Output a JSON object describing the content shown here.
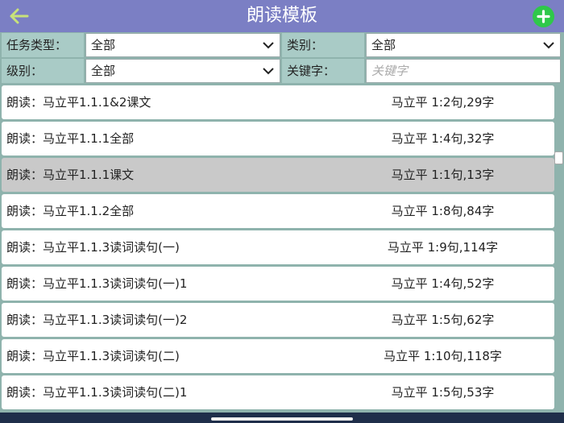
{
  "header": {
    "title": "朗读模板",
    "back_icon": "arrow-left-icon",
    "add_icon": "plus-circle-icon",
    "back_color": "#c8e27a",
    "add_color": "#2fc84a"
  },
  "filters": {
    "task_type_label": "任务类型：",
    "task_type_value": "全部",
    "category_label": "类别：",
    "category_value": "全部",
    "level_label": "级别：",
    "level_value": "全部",
    "keyword_label": "关键字：",
    "keyword_placeholder": "关键字",
    "keyword_value": ""
  },
  "list": {
    "items": [
      {
        "name": "朗读：马立平1.1.1&2课文",
        "meta": "马立平 1:2句,29字"
      },
      {
        "name": "朗读：马立平1.1.1全部",
        "meta": "马立平 1:4句,32字"
      },
      {
        "name": "朗读：马立平1.1.1课文",
        "meta": "马立平 1:1句,13字",
        "selected": true
      },
      {
        "name": "朗读：马立平1.1.2全部",
        "meta": "马立平 1:8句,84字"
      },
      {
        "name": "朗读：马立平1.1.3读词读句(一)",
        "meta": "马立平 1:9句,114字"
      },
      {
        "name": "朗读：马立平1.1.3读词读句(一)1",
        "meta": "马立平 1:4句,52字"
      },
      {
        "name": "朗读：马立平1.1.3读词读句(一)2",
        "meta": "马立平 1:5句,62字"
      },
      {
        "name": "朗读：马立平1.1.3读词读句(二)",
        "meta": "马立平 1:10句,118字"
      },
      {
        "name": "朗读：马立平1.1.3读词读句(二)1",
        "meta": "马立平 1:5句,53字"
      }
    ]
  },
  "colors": {
    "header_bg": "#7b7fc4",
    "page_bg": "#8fb3ad",
    "label_bg": "#a9cbc6",
    "selected_row_bg": "#c9c9c9"
  }
}
